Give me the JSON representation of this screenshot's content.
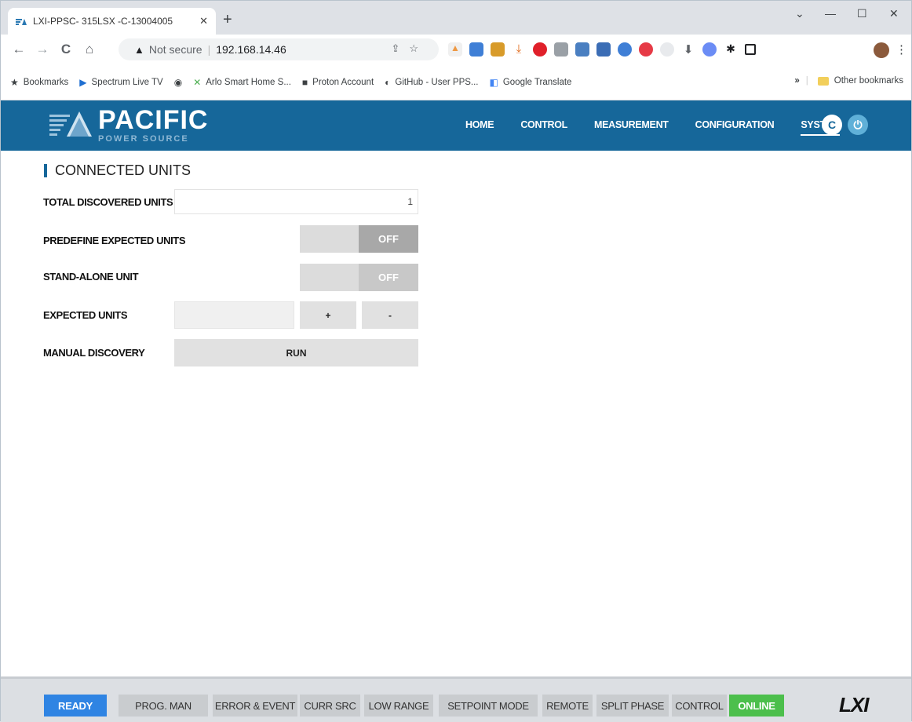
{
  "browser": {
    "tab_title": "LXI-PPSC- 315LSX -C-13004005",
    "tab_close": "✕",
    "new_tab": "+",
    "win_min": "—",
    "win_max": "☐",
    "win_close": "✕",
    "win_dropdown": "⌄",
    "nav": {
      "back": "←",
      "forward": "→",
      "reload": "C",
      "home": "⌂"
    },
    "security_warning": "Not secure",
    "url": "192.168.14.46",
    "bookmarks": [
      {
        "label": "Bookmarks",
        "icon": "star-icon",
        "glyph": "★"
      },
      {
        "label": "Spectrum Live TV",
        "icon": "play-icon",
        "glyph": "▶"
      },
      {
        "label": "",
        "icon": "globe-icon",
        "glyph": "◉"
      },
      {
        "label": "Arlo Smart Home S...",
        "icon": "arlo-icon",
        "glyph": "✕"
      },
      {
        "label": "Proton Account",
        "icon": "proton-icon",
        "glyph": "■"
      },
      {
        "label": "GitHub - User PPS...",
        "icon": "github-icon",
        "glyph": "◐"
      },
      {
        "label": "Google Translate",
        "icon": "translate-icon",
        "glyph": "◧"
      }
    ],
    "overflow": "»",
    "other_bookmarks": "Other bookmarks"
  },
  "app": {
    "brand": "PACIFIC",
    "brand_sub": "POWER SOURCE",
    "nav": [
      "HOME",
      "CONTROL",
      "MEASUREMENT",
      "CONFIGURATION",
      "SYSTEM"
    ],
    "active_nav": "SYSTEM",
    "refresh_glyph": "C",
    "power_glyph": "⏻"
  },
  "section": {
    "title": "CONNECTED UNITS",
    "total_label": "TOTAL DISCOVERED UNITS",
    "total_value": "1",
    "predefine_label": "PREDEFINE EXPECTED UNITS",
    "predefine_state": "OFF",
    "standalone_label": "STAND-ALONE UNIT",
    "standalone_state": "OFF",
    "expected_label": "EXPECTED UNITS",
    "expected_value": "",
    "plus_label": "+",
    "minus_label": "-",
    "manual_label": "MANUAL DISCOVERY",
    "run_label": "RUN"
  },
  "status": {
    "ready": "READY",
    "prog_man": "PROG. MAN",
    "error_event": "ERROR & EVENT",
    "curr_src": "CURR SRC",
    "low_range": "LOW RANGE",
    "setpoint_mode": "SETPOINT MODE",
    "remote": "REMOTE",
    "split_phase": "SPLIT PHASE",
    "control": "CONTROL",
    "online": "ONLINE",
    "lxi": "LXI"
  },
  "colors": {
    "header_bg": "#16679a",
    "ready": "#2f84e3",
    "online": "#4cbf4c",
    "toggle_off": "#a8a8a8"
  }
}
